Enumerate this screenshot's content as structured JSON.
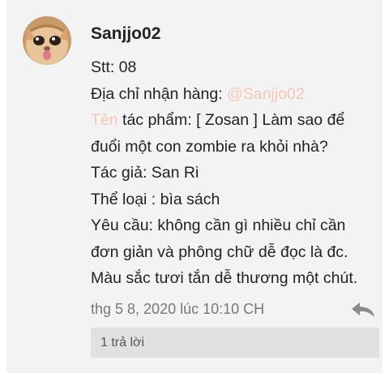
{
  "comment": {
    "username": "Sanjjo02",
    "lines": {
      "stt": "Stt: 08",
      "address_label": "Địa chỉ nhận hàng: ",
      "address_mention": "@Sanjjo02",
      "title_label": "Tên",
      "title_rest": " tác phẩm: [ Zosan ] Làm sao để",
      "title_cont": "đuổi một con zombie ra khỏi nhà?",
      "author": "Tác giả: San Ri",
      "genre": "Thể loại : bìa sách",
      "request_1": "Yêu cầu: không cần gì nhiều chỉ cần",
      "request_2": "đơn giản và phông chữ dễ đọc là đc.",
      "request_3": "Màu sắc tươi tắn dễ thương một chút."
    },
    "timestamp": "thg 5 8, 2020 lúc 10:10 CH",
    "replies_label": "1 trả lời",
    "avatar_icon": "cat-photo-avatar",
    "reply_icon": "reply-arrow-icon"
  }
}
